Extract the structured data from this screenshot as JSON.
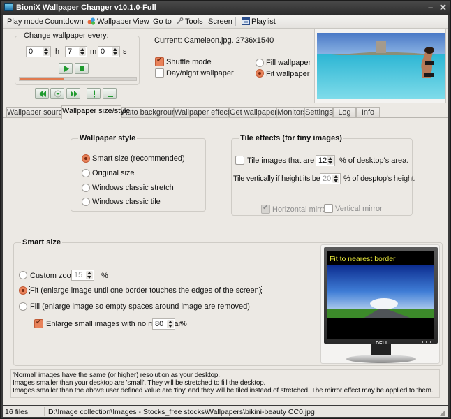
{
  "window": {
    "title": "BioniX Wallpaper Changer v10.1.0-Full",
    "minimize_glyph": "–",
    "close_glyph": "✕"
  },
  "menu": {
    "items": [
      {
        "label": "Play mode",
        "icon": null
      },
      {
        "label": "Countdown",
        "icon": null
      },
      {
        "label": "Wallpaper",
        "icon": "wallpaper-balls-icon"
      },
      {
        "label": "View",
        "icon": null
      },
      {
        "label": "Go to",
        "icon": null
      },
      {
        "label": "Tools",
        "icon": "wrench-icon"
      },
      {
        "label": "Screen",
        "icon": null
      },
      {
        "label": "Playlist",
        "icon": "playlist-window-icon"
      }
    ]
  },
  "timer": {
    "group_title": "Change wallpaper every:",
    "hours": "0",
    "hours_unit": "h",
    "minutes": "7",
    "minutes_unit": "m",
    "seconds": "0",
    "seconds_unit": "s",
    "progress_percent": 38
  },
  "controls": {
    "play": "play-icon",
    "stop": "stop-icon",
    "previous": "rewind-icon",
    "menu": "dropdown-icon",
    "next": "fast-forward-icon",
    "alert": "exclamation-icon",
    "minimize": "minimize-to-tray-icon"
  },
  "current": {
    "label": "Current: Cameleon.jpg.  2736x1540",
    "shuffle_label": "Shuffle mode",
    "shuffle_checked": true,
    "daynight_label": "Day/night wallpaper",
    "daynight_checked": false,
    "fill_label": "Fill wallpaper",
    "fill_selected": false,
    "fit_label": "Fit wallpaper",
    "fit_selected": true
  },
  "tabs": [
    {
      "label": "Wallpaper source",
      "active": false
    },
    {
      "label": "Wallpaper size/style",
      "active": true
    },
    {
      "label": "Auto background",
      "active": false
    },
    {
      "label": "Wallpaper effects",
      "active": false
    },
    {
      "label": "Get wallpapers",
      "active": false
    },
    {
      "label": "Monitors",
      "active": false
    },
    {
      "label": "Settings",
      "active": false
    },
    {
      "label": "Log",
      "active": false
    },
    {
      "label": "Info",
      "active": false
    }
  ],
  "wallpaper_style": {
    "title": "Wallpaper style",
    "options": [
      {
        "label": "Smart size (recommended)",
        "selected": true
      },
      {
        "label": "Original size",
        "selected": false
      },
      {
        "label": "Windows classic stretch",
        "selected": false
      },
      {
        "label": "Windows classic tile",
        "selected": false
      }
    ]
  },
  "tile_effects": {
    "title": "Tile effects (for tiny images)",
    "tile_under_label": "Tile images that are under",
    "tile_under_checked": false,
    "tile_under_value": "12",
    "tile_under_suffix": "% of desktop's area.",
    "tile_vert_label": "Tile vertically if height its below",
    "tile_vert_value": "20",
    "tile_vert_suffix": "% of desptop's height.",
    "hmirror_label": "Horizontal mirror",
    "hmirror_checked": true,
    "vmirror_label": "Vertical mirror",
    "vmirror_checked": false
  },
  "smart_size": {
    "title": "Smart size",
    "custom_zoom_label": "Custom zoom",
    "custom_zoom_value": "15",
    "custom_zoom_unit": "%",
    "custom_zoom_selected": false,
    "fit_label": "Fit (enlarge image until one border touches the edges of the screen)",
    "fit_selected": true,
    "fill_label": "Fill (enlarge image so empty spaces around image are removed)",
    "fill_selected": false,
    "enlarge_label": "Enlarge small images with no more than",
    "enlarge_checked": true,
    "enlarge_value": "80",
    "enlarge_unit": "%",
    "preview_caption": "Fit to nearest border",
    "monitor_brand": "DELL"
  },
  "info": {
    "lines": [
      "'Normal' images have the same (or higher) resolution as your desktop.",
      "Images smaller than your desktop are 'small'. They will be stretched to fill the desktop.",
      "Images smaller than the above user defined value are 'tiny' and they will be tiled instead of stretched. The mirror effect may be applied to them."
    ]
  },
  "status": {
    "file_count": "16 files",
    "path": "D:\\Image collection\\Images - Stocks_free stocks\\Wallpapers\\bikini-beauty CC0.jpg"
  }
}
